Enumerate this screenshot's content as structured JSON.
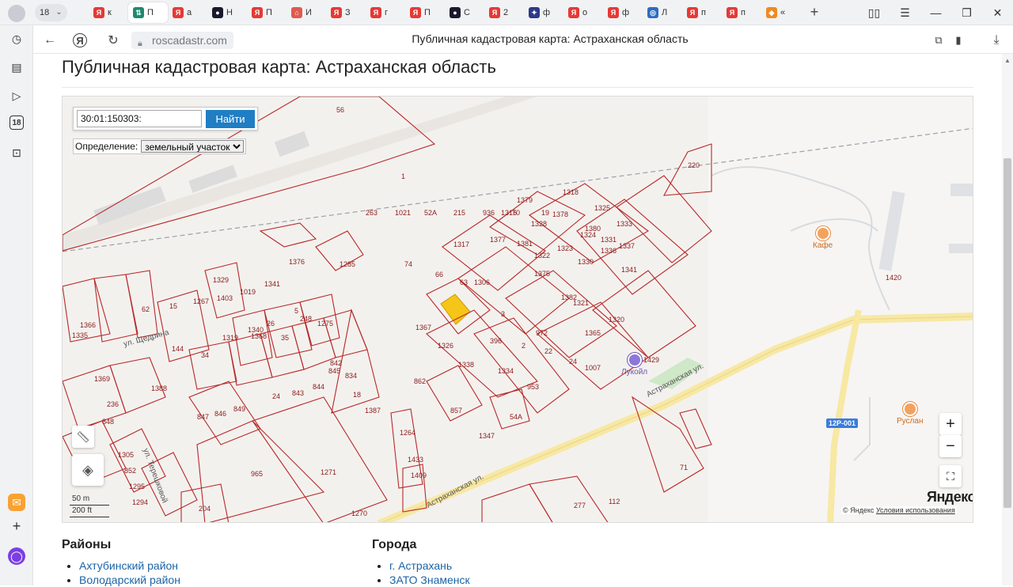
{
  "browser": {
    "tab_count": "18",
    "tabs": [
      {
        "letter": "Я",
        "label": "к",
        "color": "#e53935"
      },
      {
        "letter": "⇅",
        "label": "П",
        "color": "#1e8a6e",
        "active": true
      },
      {
        "letter": "Я",
        "label": "а",
        "color": "#e53935"
      },
      {
        "letter": "●",
        "label": "Н",
        "color": "#1a1a2e"
      },
      {
        "letter": "Я",
        "label": "П",
        "color": "#e53935"
      },
      {
        "letter": "⌂",
        "label": "И",
        "color": "#e05a4f"
      },
      {
        "letter": "Я",
        "label": "З",
        "color": "#e53935"
      },
      {
        "letter": "Я",
        "label": "г",
        "color": "#e53935"
      },
      {
        "letter": "Я",
        "label": "П",
        "color": "#e53935"
      },
      {
        "letter": "●",
        "label": "С",
        "color": "#1a1a2e"
      },
      {
        "letter": "Я",
        "label": "2",
        "color": "#e53935"
      },
      {
        "letter": "✦",
        "label": "ф",
        "color": "#2b3a8a"
      },
      {
        "letter": "Я",
        "label": "о",
        "color": "#e53935"
      },
      {
        "letter": "Я",
        "label": "ф",
        "color": "#e53935"
      },
      {
        "letter": "◎",
        "label": "Л",
        "color": "#2d6cc0"
      },
      {
        "letter": "Я",
        "label": "п",
        "color": "#e53935"
      },
      {
        "letter": "Я",
        "label": "п",
        "color": "#e53935"
      },
      {
        "letter": "◆",
        "label": "«",
        "color": "#f08a1f"
      }
    ],
    "url": "roscadastr.com",
    "page_title": "Публичная кадастровая карта: Астраханская область",
    "sidebar_badge": "18"
  },
  "page": {
    "heading": "Публичная кадастровая карта: Астраханская область"
  },
  "map": {
    "search_value": "30:01:150303:",
    "search_button": "Найти",
    "definition_label": "Определение:",
    "definition_selected": "земельный участок",
    "scale_metric": "50 m",
    "scale_imperial": "200 ft",
    "logo": "Яндекс",
    "copyright_prefix": "© Яндекс",
    "terms_link": "Условия использования",
    "zoom_in": "+",
    "zoom_out": "−",
    "road_badge": "12Р-001",
    "pois": {
      "cafe": "Кафе",
      "lukoil": "Лукойл",
      "ruslan": "Руслан"
    },
    "street_labels": [
      "ул. Щедрина",
      "ул. Терешковой",
      "Астраханская ул.",
      "Астраханская ул."
    ],
    "parcel_numbers": [
      "56",
      "1",
      "220",
      "1318",
      "1325",
      "1333",
      "1379",
      "1315",
      "1328",
      "1378",
      "1380",
      "1324",
      "1331",
      "1337",
      "1317",
      "1377",
      "1381",
      "1322",
      "1323",
      "1330",
      "1336",
      "1341",
      "1376",
      "1285",
      "74",
      "66",
      "1306",
      "1375",
      "1382",
      "1321",
      "1320",
      "1329",
      "1341",
      "62",
      "15",
      "1267",
      "1403",
      "1019",
      "5",
      "63",
      "3",
      "972",
      "1365",
      "1366",
      "1335",
      "1340",
      "26",
      "35",
      "248",
      "1275",
      "1367",
      "396",
      "2",
      "22",
      "24",
      "1007",
      "144",
      "34",
      "1368",
      "1319",
      "1326",
      "1334",
      "1338",
      "953",
      "842",
      "834",
      "18",
      "1387",
      "1369",
      "1388",
      "24",
      "843",
      "844",
      "845",
      "862",
      "857",
      "236",
      "848",
      "847",
      "846",
      "849",
      "54А",
      "1264",
      "1347",
      "1305",
      "852",
      "1295",
      "1294",
      "965",
      "1271",
      "1433",
      "1409",
      "71",
      "204",
      "1270",
      "277",
      "112",
      "1420",
      "1429",
      "263",
      "1021",
      "52А",
      "215",
      "936",
      "70",
      "19"
    ]
  },
  "regions": {
    "heading": "Районы",
    "items": [
      "Ахтубинский район",
      "Володарский район"
    ]
  },
  "cities": {
    "heading": "Города",
    "items": [
      "г. Астрахань",
      "ЗАТО Знаменск"
    ]
  }
}
